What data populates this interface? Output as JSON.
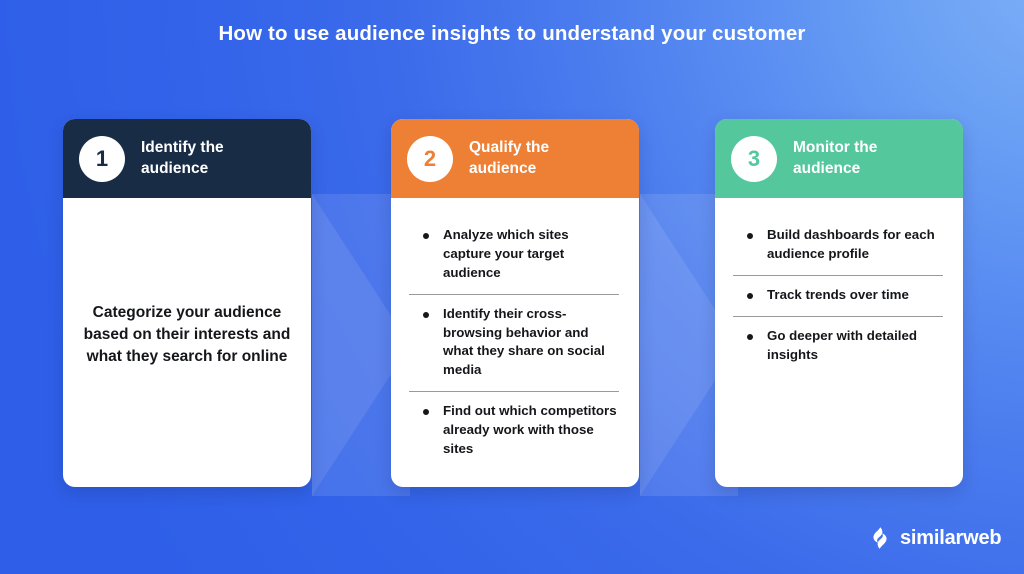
{
  "page": {
    "title": "How to use audience insights to understand your customer",
    "background_color": "#2f5fe8",
    "background_accent_color": "#7fb0f7"
  },
  "cards": [
    {
      "number": "1",
      "title": "Identify the\naudience",
      "header_color": "#182c45",
      "number_color": "#182c45",
      "body_type": "paragraph",
      "paragraph": "Categorize your audience based on their interests and what they search for online",
      "bullets": []
    },
    {
      "number": "2",
      "title": "Qualify the\naudience",
      "header_color": "#ee8036",
      "number_color": "#ee8036",
      "body_type": "list",
      "paragraph": "",
      "bullets": [
        "Analyze which sites capture your target audience",
        "Identify their cross-browsing behavior and what they share on social media",
        "Find out which competitors  already work with those sites"
      ]
    },
    {
      "number": "3",
      "title": "Monitor the\naudience",
      "header_color": "#55c79d",
      "number_color": "#55c79d",
      "body_type": "list",
      "paragraph": "",
      "bullets": [
        "Build dashboards for each audience profile",
        "Track trends over time",
        "Go deeper with detailed insights"
      ]
    }
  ],
  "logo": {
    "mark": "similarweb-droplet-icon",
    "text": "similarweb"
  }
}
